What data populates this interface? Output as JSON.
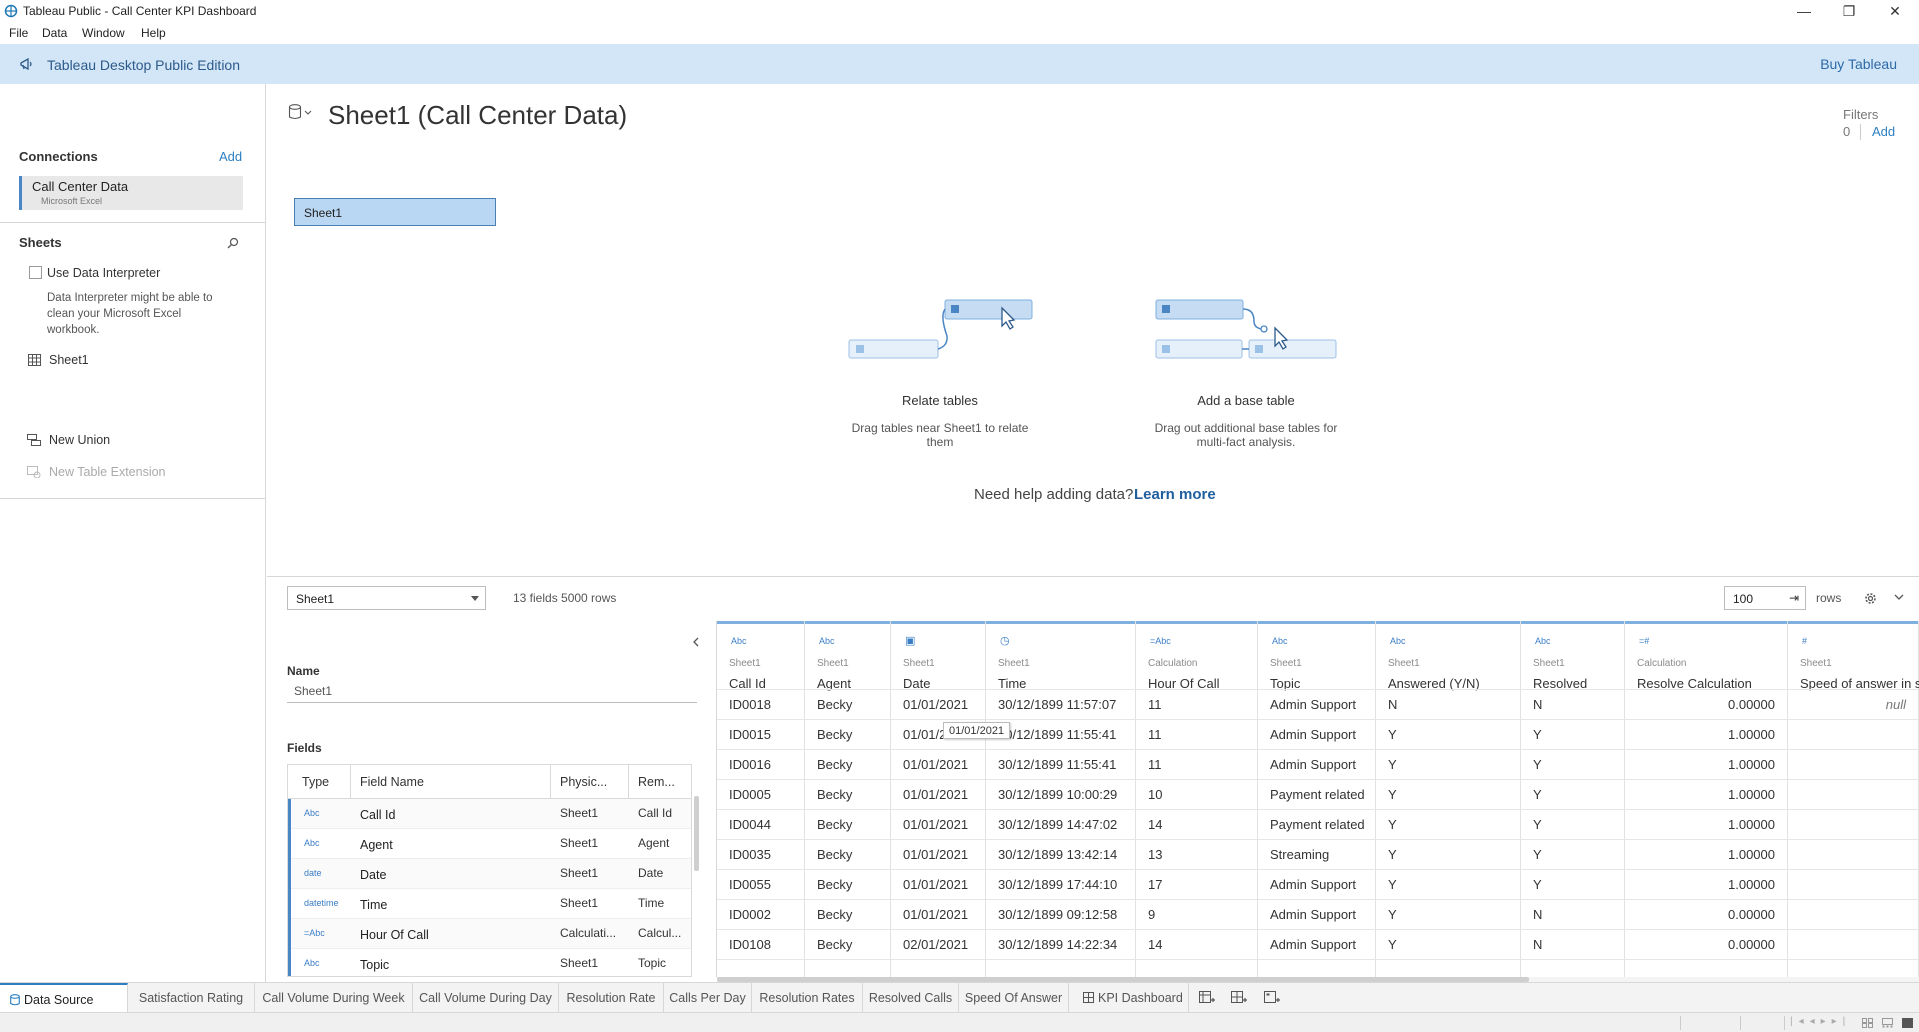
{
  "window": {
    "title": "Tableau Public - Call Center KPI Dashboard",
    "minimize": "—",
    "restore": "❐",
    "close": "✕"
  },
  "menu": [
    "File",
    "Data",
    "Window",
    "Help"
  ],
  "banner": {
    "edition": "Tableau Desktop Public Edition",
    "buy": "Buy Tableau"
  },
  "connections": {
    "title": "Connections",
    "add": "Add",
    "item_name": "Call Center Data",
    "item_type": "Microsoft Excel"
  },
  "sheets": {
    "title": "Sheets",
    "use_interpreter": "Use Data Interpreter",
    "interpreter_desc": [
      "Data Interpreter might be able to",
      "clean your Microsoft Excel",
      "workbook."
    ],
    "sheet_item": "Sheet1",
    "new_union": "New Union",
    "new_extension": "New Table Extension"
  },
  "main": {
    "title": "Sheet1 (Call Center Data)",
    "filters_label": "Filters",
    "filters_count": "0",
    "filters_add": "Add",
    "canvas_table": "Sheet1",
    "relate_title": "Relate tables",
    "relate_desc": [
      "Drag tables near Sheet1 to relate",
      "them"
    ],
    "base_title": "Add a base table",
    "base_desc": [
      "Drag out additional base tables for",
      "multi-fact analysis."
    ],
    "help_text": "Need help adding data?",
    "learn_more": "Learn more"
  },
  "bottom": {
    "table_select": "Sheet1",
    "summary": "13 fields 5000 rows",
    "rows_value": "100",
    "rows_label": "rows"
  },
  "details": {
    "name_label": "Name",
    "name_value": "Sheet1",
    "fields_label": "Fields",
    "headers": [
      "Type",
      "Field Name",
      "Physic...",
      "Rem..."
    ],
    "rows": [
      {
        "type": "Abc",
        "name": "Call Id",
        "phys": "Sheet1",
        "rem": "Call Id"
      },
      {
        "type": "Abc",
        "name": "Agent",
        "phys": "Sheet1",
        "rem": "Agent"
      },
      {
        "type": "date",
        "name": "Date",
        "phys": "Sheet1",
        "rem": "Date"
      },
      {
        "type": "datetime",
        "name": "Time",
        "phys": "Sheet1",
        "rem": "Time"
      },
      {
        "type": "=Abc",
        "name": "Hour Of Call",
        "phys": "Calculati...",
        "rem": "Calcul..."
      },
      {
        "type": "Abc",
        "name": "Topic",
        "phys": "Sheet1",
        "rem": "Topic"
      }
    ]
  },
  "grid": {
    "columns": [
      {
        "icon": "Abc",
        "src": "Sheet1",
        "name": "Call Id"
      },
      {
        "icon": "Abc",
        "src": "Sheet1",
        "name": "Agent"
      },
      {
        "icon": "date",
        "src": "Sheet1",
        "name": "Date"
      },
      {
        "icon": "datetime",
        "src": "Sheet1",
        "name": "Time"
      },
      {
        "icon": "=Abc",
        "src": "Calculation",
        "name": "Hour Of Call"
      },
      {
        "icon": "Abc",
        "src": "Sheet1",
        "name": "Topic"
      },
      {
        "icon": "Abc",
        "src": "Sheet1",
        "name": "Answered (Y/N)"
      },
      {
        "icon": "Abc",
        "src": "Sheet1",
        "name": "Resolved"
      },
      {
        "icon": "=#",
        "src": "Calculation",
        "name": "Resolve Calculation"
      },
      {
        "icon": "#",
        "src": "Sheet1",
        "name": "Speed of answer in se"
      }
    ],
    "rows": [
      [
        "ID0018",
        "Becky",
        "01/01/2021",
        "30/12/1899 11:57:07",
        "11",
        "Admin Support",
        "N",
        "N",
        "0.00000",
        "null"
      ],
      [
        "ID0015",
        "Becky",
        "01/01/2021",
        "30/12/1899 11:55:41",
        "11",
        "Admin Support",
        "Y",
        "Y",
        "1.00000",
        ""
      ],
      [
        "ID0016",
        "Becky",
        "01/01/2021",
        "30/12/1899 11:55:41",
        "11",
        "Admin Support",
        "Y",
        "Y",
        "1.00000",
        ""
      ],
      [
        "ID0005",
        "Becky",
        "01/01/2021",
        "30/12/1899 10:00:29",
        "10",
        "Payment related",
        "Y",
        "Y",
        "1.00000",
        ""
      ],
      [
        "ID0044",
        "Becky",
        "01/01/2021",
        "30/12/1899 14:47:02",
        "14",
        "Payment related",
        "Y",
        "Y",
        "1.00000",
        ""
      ],
      [
        "ID0035",
        "Becky",
        "01/01/2021",
        "30/12/1899 13:42:14",
        "13",
        "Streaming",
        "Y",
        "Y",
        "1.00000",
        ""
      ],
      [
        "ID0055",
        "Becky",
        "01/01/2021",
        "30/12/1899 17:44:10",
        "17",
        "Admin Support",
        "Y",
        "Y",
        "1.00000",
        ""
      ],
      [
        "ID0002",
        "Becky",
        "01/01/2021",
        "30/12/1899 09:12:58",
        "9",
        "Admin Support",
        "Y",
        "N",
        "0.00000",
        ""
      ],
      [
        "ID0108",
        "Becky",
        "02/01/2021",
        "30/12/1899 14:22:34",
        "14",
        "Admin Support",
        "Y",
        "N",
        "0.00000",
        ""
      ]
    ],
    "tooltip": "01/01/2021"
  },
  "tabs": {
    "data_source": "Data Source",
    "sheets": [
      "Satisfaction Rating",
      "Call Volume During Week",
      "Call Volume During Day",
      "Resolution Rate",
      "Calls Per Day",
      "Resolution Rates",
      "Resolved Calls",
      "Speed Of Answer"
    ],
    "dashboard": "KPI Dashboard"
  },
  "colors": {
    "accent": "#2d7fc1",
    "banner": "#d3e6f7",
    "selected_table": "#b9d6f2"
  }
}
